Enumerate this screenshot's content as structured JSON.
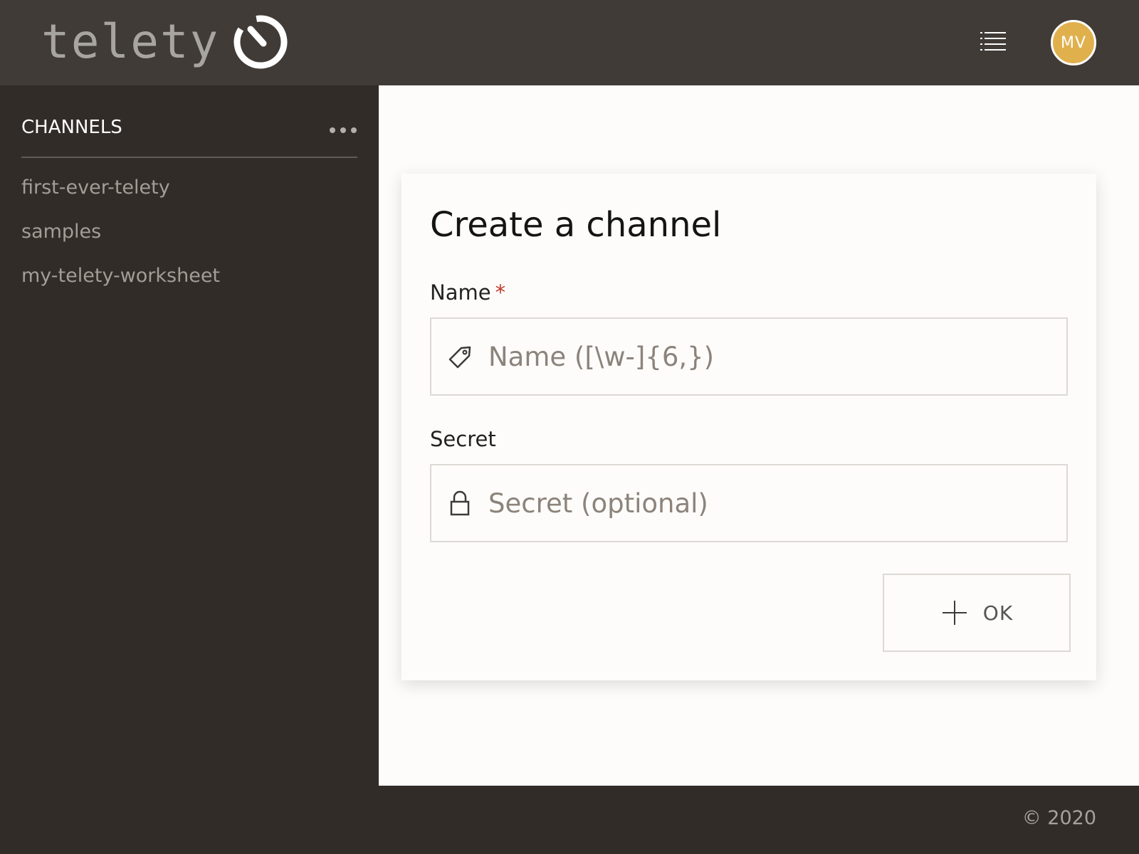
{
  "header": {
    "logo_text": "telety",
    "menu_icon": "list-icon",
    "avatar_initials": "MV",
    "avatar_color": "#e0b04d"
  },
  "sidebar": {
    "title": "CHANNELS",
    "more_icon": "ellipsis-icon",
    "channels": [
      {
        "label": "first-ever-telety"
      },
      {
        "label": "samples"
      },
      {
        "label": "my-telety-worksheet"
      }
    ]
  },
  "form": {
    "title": "Create a channel",
    "name_label": "Name",
    "required_mark": "*",
    "name_placeholder": "Name ([\\w-]{6,})",
    "name_value": "",
    "name_icon": "tag-icon",
    "secret_label": "Secret",
    "secret_placeholder": "Secret (optional)",
    "secret_value": "",
    "secret_icon": "lock-icon",
    "ok_label": "OK",
    "ok_icon": "plus-icon"
  },
  "footer": {
    "copyright": "© 2020"
  },
  "colors": {
    "header_bg": "#403b37",
    "sidebar_bg": "#312c28",
    "required": "#c0392b",
    "accent": "#e0b04d"
  }
}
